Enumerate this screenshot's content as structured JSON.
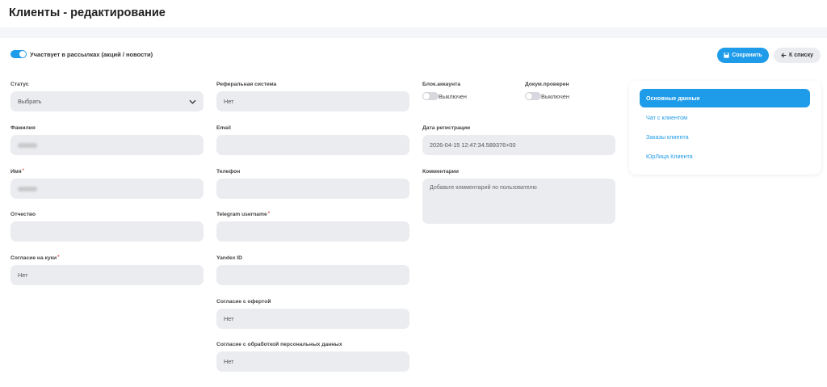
{
  "page": {
    "title": "Клиенты - редактирование"
  },
  "mailing": {
    "label": "Участвует в рассылках (акций / новости)",
    "enabled": true
  },
  "toolbar": {
    "save_label": "Сохранить",
    "back_label": "К списку"
  },
  "col1": {
    "status": {
      "label": "Статус",
      "value": "Выбрать"
    },
    "surname": {
      "label": "Фамилия"
    },
    "name": {
      "label": "Имя",
      "required": "*"
    },
    "patronymic": {
      "label": "Отчество"
    },
    "cookie": {
      "label": "Согласие на куки",
      "required": "*",
      "value": "Нет"
    }
  },
  "col2": {
    "referral": {
      "label": "Реферальная система",
      "value": "Нет"
    },
    "email": {
      "label": "Email"
    },
    "phone": {
      "label": "Телефон"
    },
    "telegram": {
      "label": "Telegram username",
      "required": "*"
    },
    "yandex": {
      "label": "Yandex ID"
    },
    "offer": {
      "label": "Согласие с офертой",
      "value": "Нет"
    },
    "personal": {
      "label": "Согласие с обработкой персональных данных",
      "value": "Нет"
    }
  },
  "col3": {
    "block": {
      "label": "Блок.аккаунта",
      "state": "Выключен"
    },
    "docs": {
      "label": "Докум.проверен",
      "state": "Выключен"
    },
    "regdate": {
      "label": "Дата регистрации",
      "value": "2026-04-15 12:47:34.589376+00"
    },
    "comments": {
      "label": "Комментарии",
      "placeholder": "Добавьте комментарий по пользователю"
    }
  },
  "sidebar": {
    "items": [
      {
        "label": "Основные данные",
        "active": true
      },
      {
        "label": "Чат с клиентом"
      },
      {
        "label": "Заказы клиента"
      },
      {
        "label": "ЮрЛица Клиента"
      }
    ]
  },
  "colors": {
    "accent": "#1e9be9",
    "field_bg": "#ebecef",
    "band_bg": "#f4f5f9"
  },
  "icons": {
    "save": "floppy-disk-icon",
    "back": "arrow-left-icon",
    "select": "chevron-down-icon"
  }
}
